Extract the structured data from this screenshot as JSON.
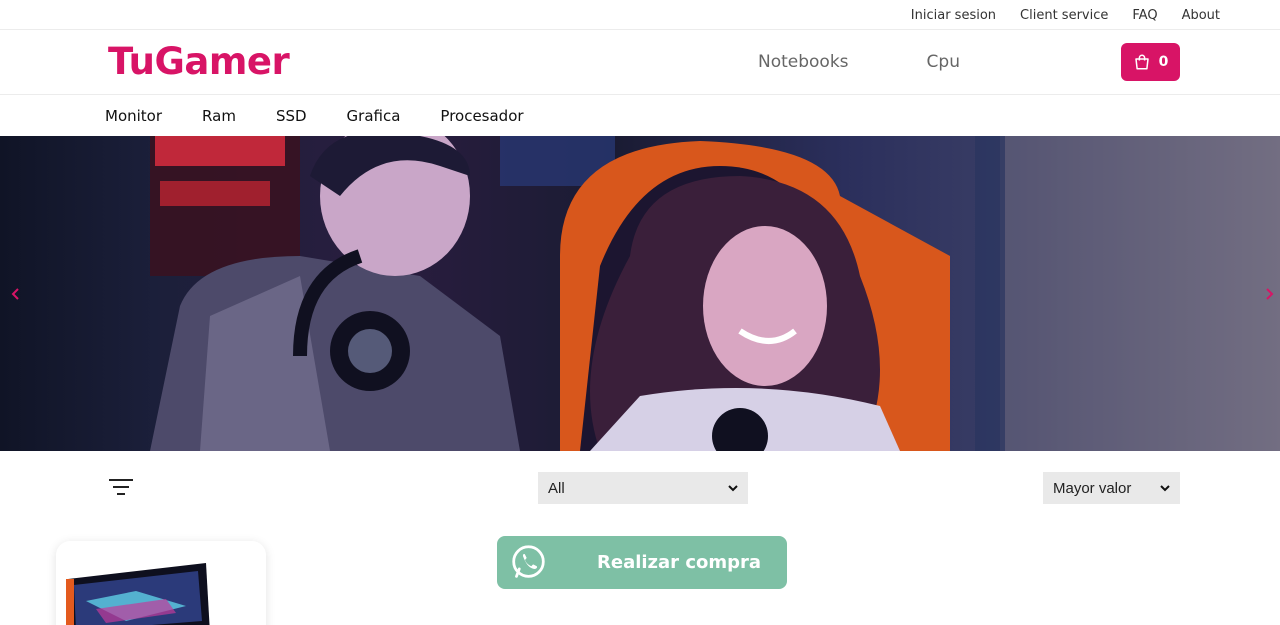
{
  "topbar": {
    "links": [
      "Iniciar sesion",
      "Client service",
      "FAQ",
      "About"
    ]
  },
  "header": {
    "logo": "TuGamer",
    "nav": [
      "Notebooks",
      "Cpu"
    ],
    "cart_count": "0"
  },
  "categories": [
    "Monitor",
    "Ram",
    "SSD",
    "Grafica",
    "Procesador"
  ],
  "hero": {
    "prev_icon": "chevron-left-icon",
    "next_icon": "chevron-right-icon"
  },
  "filters": {
    "category_selected": "All",
    "sort_selected": "Mayor valor",
    "filter_icon": "filter-lines-icon"
  },
  "buy_button": {
    "label": "Realizar compra",
    "icon": "whatsapp-icon"
  },
  "colors": {
    "brand": "#d81466",
    "buy": "#7ec0a5"
  }
}
